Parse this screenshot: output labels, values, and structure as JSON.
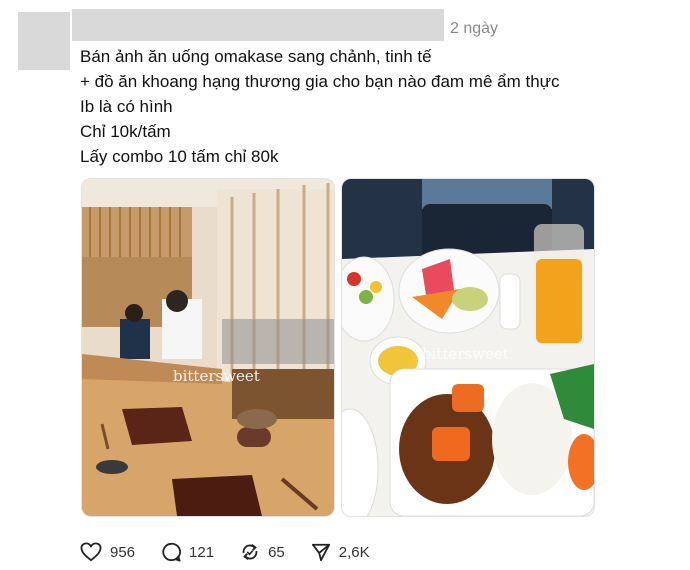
{
  "post": {
    "time": "2 ngày",
    "lines": [
      "Bán ảnh ăn uống omakase sang chảnh, tinh tế",
      "+ đồ ăn khoang hạng thương gia cho bạn nào đam mê ẩm thực",
      "Ib là có hình",
      "Chỉ 10k/tấm",
      "Lấy combo 10 tấm chỉ 80k"
    ]
  },
  "images": [
    {
      "watermark": "bittersweet"
    },
    {
      "watermark": "bittersweet"
    }
  ],
  "actions": {
    "likes": "956",
    "comments": "121",
    "reposts": "65",
    "shares": "2,6K"
  },
  "icons": [
    "heart-icon",
    "comment-icon",
    "repost-icon",
    "share-icon"
  ]
}
